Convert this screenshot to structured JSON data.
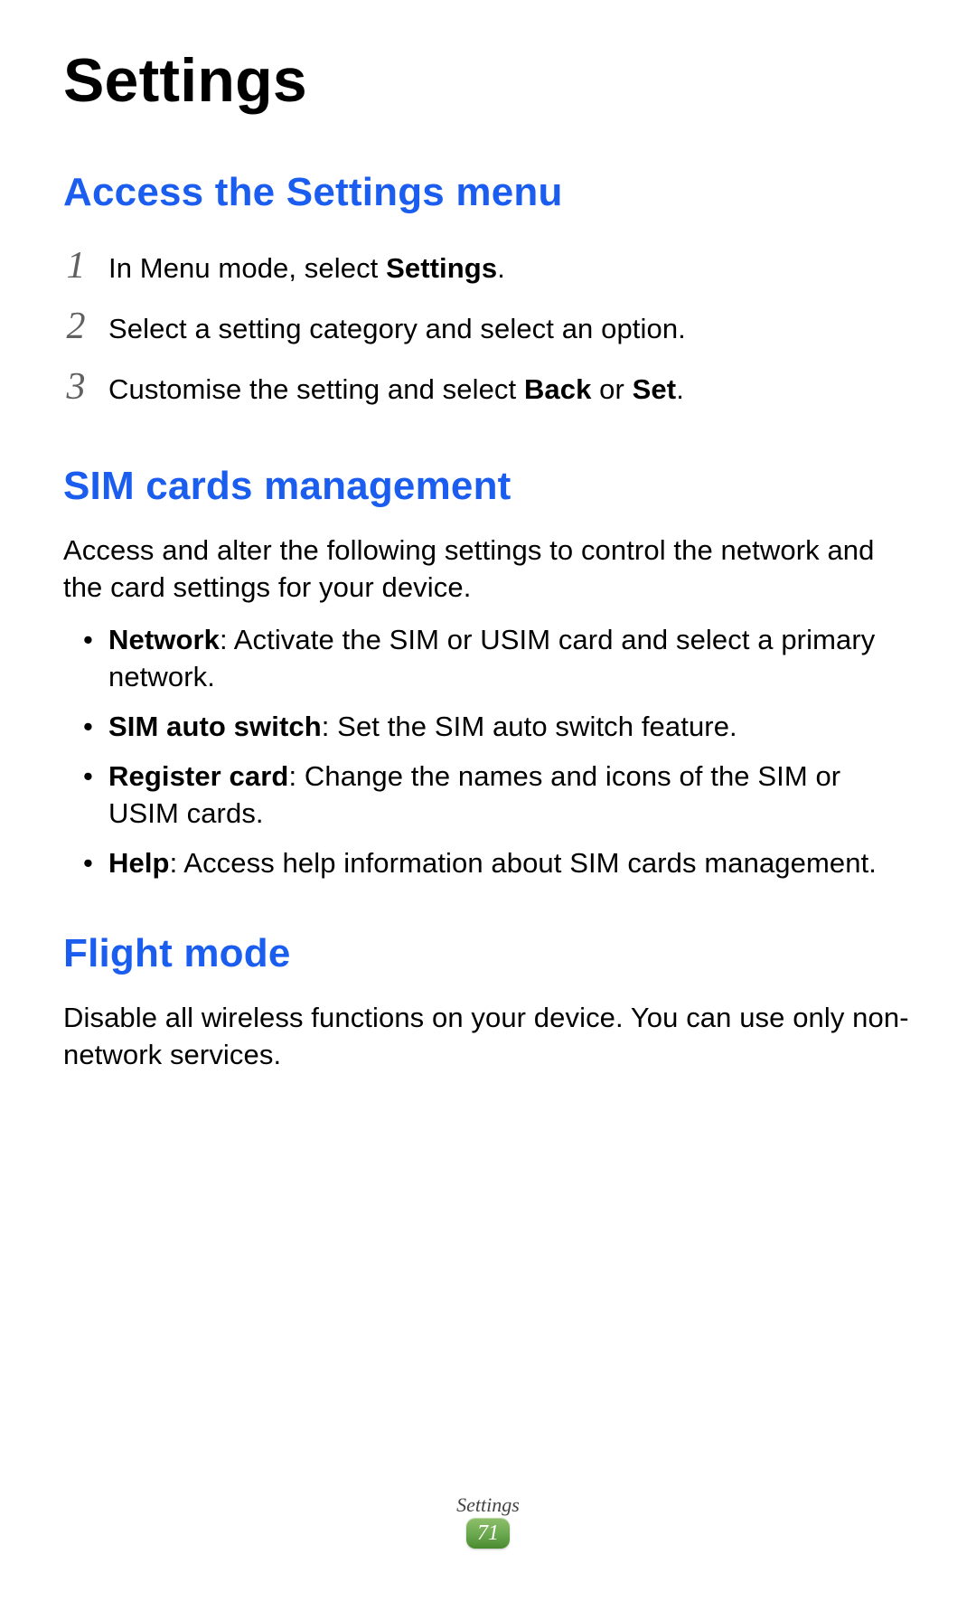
{
  "title": "Settings",
  "section1": {
    "heading": "Access the Settings menu",
    "steps": [
      {
        "num": "1",
        "pre": "In Menu mode, select ",
        "bold": "Settings",
        "post": "."
      },
      {
        "num": "2",
        "pre": "Select a setting category and select an option.",
        "bold": "",
        "post": ""
      },
      {
        "num": "3",
        "pre": "Customise the setting and select ",
        "bold": "Back",
        "mid": " or ",
        "bold2": "Set",
        "post": "."
      }
    ]
  },
  "section2": {
    "heading": "SIM cards management",
    "intro": "Access and alter the following settings to control the network and the card settings for your device.",
    "bullets": [
      {
        "bold": "Network",
        "text": ": Activate the SIM or USIM card and select a primary network."
      },
      {
        "bold": "SIM auto switch",
        "text": ": Set the SIM auto switch feature."
      },
      {
        "bold": "Register card",
        "text": ": Change the names and icons of the SIM or USIM cards."
      },
      {
        "bold": "Help",
        "text": ": Access help information about SIM cards management."
      }
    ]
  },
  "section3": {
    "heading": "Flight mode",
    "body": "Disable all wireless functions on your device. You can use only non-network services."
  },
  "footer": {
    "label": "Settings",
    "page": "71"
  }
}
